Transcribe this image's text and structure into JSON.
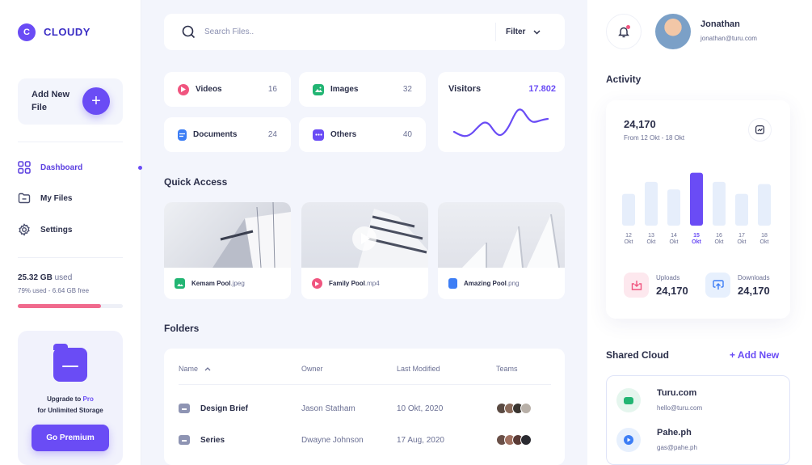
{
  "brand": {
    "initial": "C",
    "name": "CLOUDY"
  },
  "sidebar": {
    "add_new_label": "Add New File",
    "nav": [
      {
        "label": "Dashboard",
        "icon": "grid-icon",
        "active": true
      },
      {
        "label": "My Files",
        "icon": "folder-icon"
      },
      {
        "label": "Settings",
        "icon": "gear-icon"
      }
    ],
    "storage": {
      "used_value": "25.32 GB",
      "used_suffix": "used",
      "detail": "79% used - 6.64 GB free",
      "percent": 79
    },
    "upgrade": {
      "line1_prefix": "Upgrade to ",
      "line1_pro": "Pro",
      "line2": "for Unlimited Storage",
      "button": "Go Premium"
    }
  },
  "search": {
    "placeholder": "Search Files..",
    "filter_label": "Filter"
  },
  "categories": [
    {
      "label": "Videos",
      "count": "16",
      "color": "#f0557f",
      "icon": "play-icon"
    },
    {
      "label": "Images",
      "count": "32",
      "color": "#22b573",
      "icon": "image-icon"
    },
    {
      "label": "Documents",
      "count": "24",
      "color": "#3d7ef5",
      "icon": "document-icon"
    },
    {
      "label": "Others",
      "count": "40",
      "color": "#6a4cf5",
      "icon": "more-icon"
    }
  ],
  "visitors": {
    "title": "Visitors",
    "value": "17.802"
  },
  "quick_access": {
    "title": "Quick Access",
    "items": [
      {
        "name": "Kemam Pool",
        "ext": ".jpeg",
        "type": "image"
      },
      {
        "name": "Family Pool",
        "ext": ".mp4",
        "type": "video"
      },
      {
        "name": "Amazing Pool",
        "ext": ".png",
        "type": "document"
      }
    ]
  },
  "folders": {
    "title": "Folders",
    "headers": {
      "name": "Name",
      "owner": "Owner",
      "modified": "Last Modified",
      "teams": "Teams"
    },
    "rows": [
      {
        "name": "Design Brief",
        "owner": "Jason Statham",
        "modified": "10 Okt, 2020"
      },
      {
        "name": "Series",
        "owner": "Dwayne Johnson",
        "modified": "17 Aug, 2020"
      }
    ]
  },
  "user": {
    "name": "Jonathan",
    "email": "jonathan@turu.com"
  },
  "activity": {
    "title": "Activity",
    "value": "24,170",
    "range": "From 12 Okt - 18 Okt",
    "chart_data": {
      "type": "bar",
      "categories": [
        "12 Okt",
        "13 Okt",
        "14 Okt",
        "15 Okt",
        "16 Okt",
        "17 Okt",
        "18 Okt"
      ],
      "day_labels": [
        "12",
        "13",
        "14",
        "15",
        "16",
        "17",
        "18"
      ],
      "month_label": "Okt",
      "values": [
        42,
        58,
        48,
        70,
        58,
        42,
        55
      ],
      "highlight_index": 3,
      "ylim": [
        0,
        75
      ]
    },
    "uploads": {
      "label": "Uploads",
      "value": "24,170"
    },
    "downloads": {
      "label": "Downloads",
      "value": "24,170"
    }
  },
  "shared_cloud": {
    "title": "Shared Cloud",
    "add_label": "+ Add New",
    "items": [
      {
        "name": "Turu.com",
        "email": "hello@turu.com",
        "color": "#22b573"
      },
      {
        "name": "Pahe.ph",
        "email": "gas@pahe.ph",
        "color": "#3d7ef5"
      }
    ]
  }
}
